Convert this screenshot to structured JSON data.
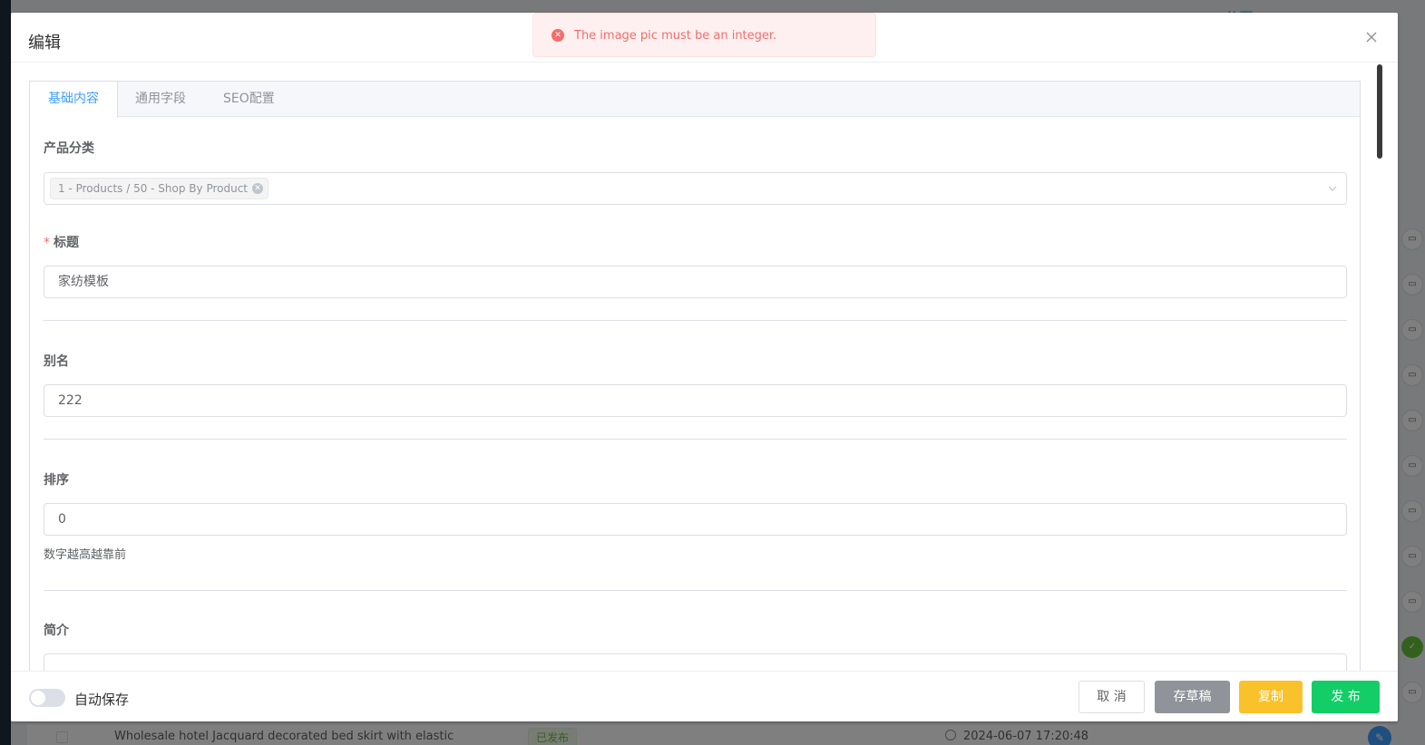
{
  "background": {
    "company_fragment": "公司",
    "row": {
      "title": "Wholesale hotel Jacquard decorated bed skirt with elastic",
      "status": "已发布",
      "time": "2024-06-07 17:20:48"
    }
  },
  "toast": {
    "type": "error",
    "message": "The image pic must be an integer."
  },
  "dialog": {
    "title": "编辑",
    "tabs": [
      {
        "label": "基础内容",
        "active": true
      },
      {
        "label": "通用字段",
        "active": false
      },
      {
        "label": "SEO配置",
        "active": false
      }
    ],
    "form": {
      "category": {
        "label": "产品分类",
        "selected_tag": "1 - Products / 50 - Shop By Product"
      },
      "title": {
        "label": "标题",
        "required_mark": "*",
        "value": "家纺模板"
      },
      "alias": {
        "label": "别名",
        "value": "222"
      },
      "sort": {
        "label": "排序",
        "value": "0",
        "hint": "数字越高越靠前"
      },
      "summary": {
        "label": "简介",
        "value": ""
      }
    },
    "footer": {
      "autosave_label": "自动保存",
      "autosave_on": false,
      "cancel_label": "取 消",
      "draft_label": "存草稿",
      "copy_label": "复制",
      "publish_label": "发 布"
    }
  },
  "colors": {
    "primary": "#409eff",
    "error": "#f56c6c",
    "draft": "#909399",
    "copy": "#f9c22a",
    "publish": "#13ce66"
  }
}
